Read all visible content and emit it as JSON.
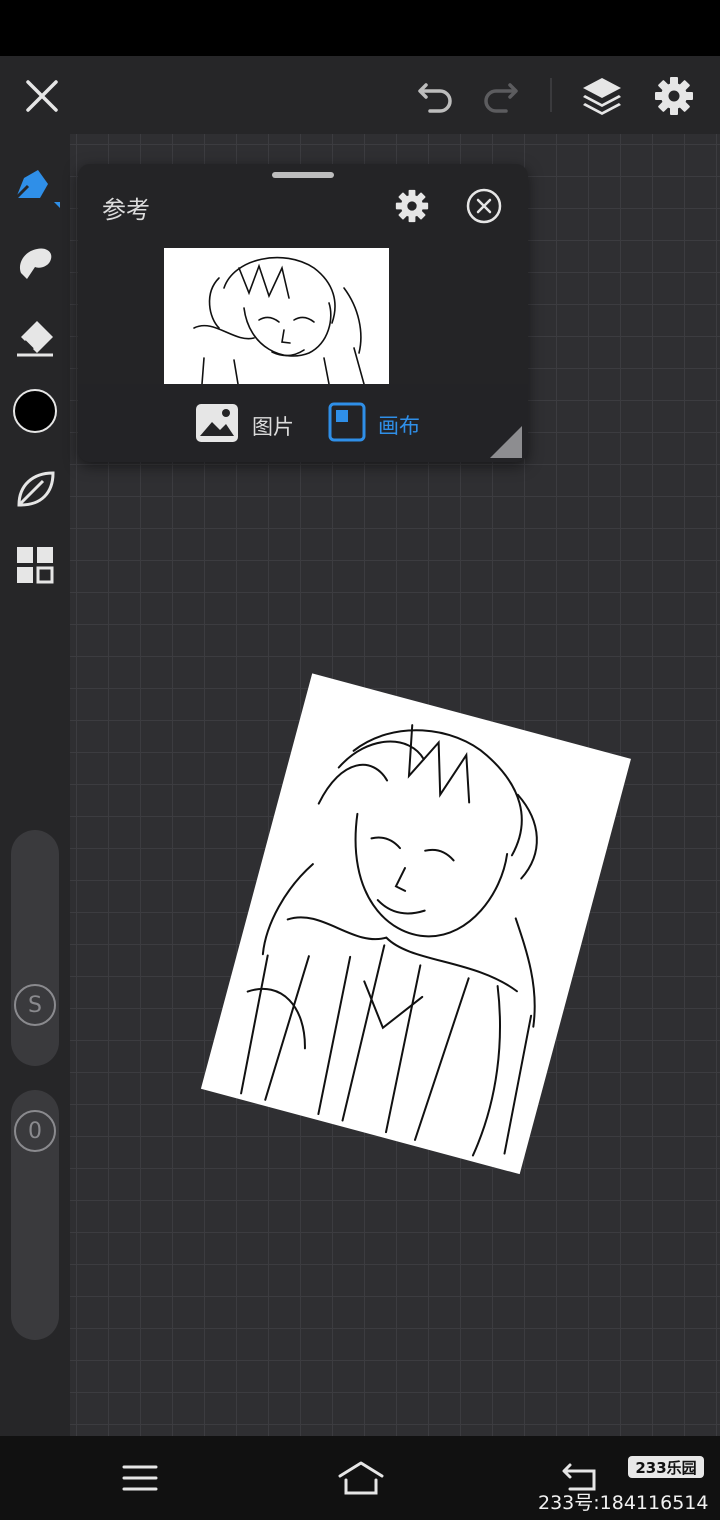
{
  "top_bar": {
    "close_icon": "close-icon",
    "undo_icon": "undo-icon",
    "redo_icon": "redo-icon",
    "layers_icon": "layers-icon",
    "settings_icon": "gear-icon"
  },
  "sidebar": {
    "tools": [
      "pen-icon",
      "brush-icon",
      "eraser-icon",
      "color-swatch",
      "leaf-icon",
      "grid-icon"
    ],
    "active_color": "#000000",
    "accent": "#2f8fe8",
    "size_label": "S",
    "opacity_label": "0"
  },
  "reference_panel": {
    "title": "参考",
    "options": [
      {
        "label": "图片",
        "icon": "image-icon",
        "active": false
      },
      {
        "label": "画布",
        "icon": "canvas-icon",
        "active": true
      }
    ]
  },
  "nav_bar": {
    "menu_icon": "menu-icon",
    "home_icon": "home-icon",
    "back_icon": "back-icon"
  },
  "watermark": {
    "badge": "233乐园",
    "id_text": "233号:184116514"
  }
}
